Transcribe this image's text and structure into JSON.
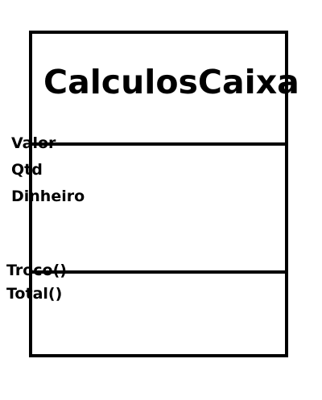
{
  "class_box": {
    "name": "CalculosCaixa",
    "attributes": [
      {
        "label": "Valor"
      },
      {
        "label": "Qtd"
      },
      {
        "label": "Dinheiro"
      }
    ],
    "methods": [
      {
        "label": "Troco()"
      },
      {
        "label": "Total()"
      }
    ]
  }
}
